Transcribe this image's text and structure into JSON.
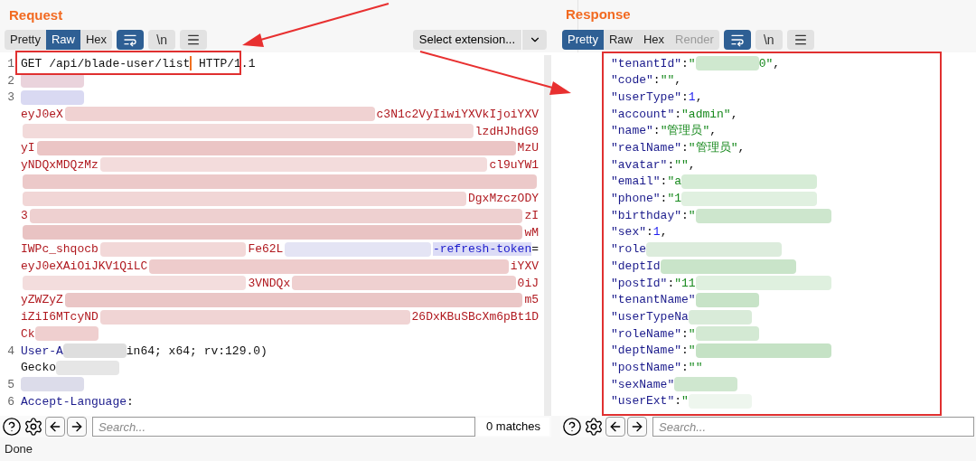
{
  "request": {
    "title": "Request",
    "view_tabs": [
      {
        "label": "Pretty",
        "selected": false
      },
      {
        "label": "Raw",
        "selected": true
      },
      {
        "label": "Hex",
        "selected": false
      }
    ],
    "tool_buttons": [
      {
        "kind": "wrap",
        "selected": true
      },
      {
        "kind": "newline",
        "label": "\\n",
        "selected": false
      },
      {
        "kind": "menu",
        "selected": false
      }
    ],
    "extension_select": "Select extension...",
    "lines": [
      {
        "number": "1",
        "segments": [
          {
            "kind": "plain",
            "text": "GET /api/blade-user/list"
          },
          {
            "kind": "caret"
          },
          {
            "kind": "plain",
            "text": " HTTP/1.1"
          }
        ]
      },
      {
        "number": "2",
        "segments": [
          {
            "kind": "blur_part",
            "color": "#ead3dc"
          }
        ]
      },
      {
        "number": "3",
        "segments": [
          {
            "kind": "blur_part",
            "color": "#d9d9f2"
          }
        ]
      },
      {
        "segments": [
          {
            "kind": "value",
            "text": "eyJ0eX"
          },
          {
            "kind": "blur",
            "color": "#f0d2d2"
          },
          {
            "kind": "value",
            "text": "c3N1c2VyIiwiYXVkIjoiYXV"
          }
        ]
      },
      {
        "segments": [
          {
            "kind": "blur",
            "color": "#f2dada"
          },
          {
            "kind": "value",
            "text": "lzdHJhdG9"
          }
        ]
      },
      {
        "segments": [
          {
            "kind": "value",
            "text": "yI"
          },
          {
            "kind": "blur",
            "color": "#ebc5c5"
          },
          {
            "kind": "value",
            "text": "MzU"
          }
        ]
      },
      {
        "segments": [
          {
            "kind": "value",
            "text": "yNDQxMDQzMz"
          },
          {
            "kind": "blur",
            "color": "#f3dcdc"
          },
          {
            "kind": "value",
            "text": "cl9uYW1"
          }
        ]
      },
      {
        "segments": [
          {
            "kind": "blur",
            "color": "#ecc9c9"
          }
        ]
      },
      {
        "segments": [
          {
            "kind": "blur",
            "color": "#f1d6d6"
          },
          {
            "kind": "value",
            "text": "DgxMzczODY"
          }
        ]
      },
      {
        "segments": [
          {
            "kind": "value",
            "text": "3"
          },
          {
            "kind": "blur",
            "color": "#eed0d0"
          },
          {
            "kind": "value",
            "text": "zI"
          }
        ]
      },
      {
        "segments": [
          {
            "kind": "blur",
            "color": "#e9c3c3"
          },
          {
            "kind": "value",
            "text": "wM"
          }
        ]
      },
      {
        "segments": [
          {
            "kind": "value",
            "text": "IWPc_shqocb"
          },
          {
            "kind": "blur",
            "color": "#f2d8d8"
          },
          {
            "kind": "value",
            "text": "Fe62L"
          },
          {
            "kind": "blur",
            "color": "#e4e4f4"
          },
          {
            "kind": "param",
            "text": "-refresh-token"
          },
          {
            "kind": "plain",
            "text": "="
          }
        ]
      },
      {
        "segments": [
          {
            "kind": "value",
            "text": "eyJ0eXAiOiJKV1QiLC"
          },
          {
            "kind": "blur",
            "color": "#eecccc"
          },
          {
            "kind": "value",
            "text": "iYXV"
          }
        ]
      },
      {
        "segments": [
          {
            "kind": "blur",
            "color": "#f3dddd"
          },
          {
            "kind": "value",
            "text": "3VNDQx"
          },
          {
            "kind": "blur",
            "color": "#efd0d0"
          },
          {
            "kind": "value",
            "text": "0iJ"
          }
        ]
      },
      {
        "segments": [
          {
            "kind": "value",
            "text": "yZWZyZ"
          },
          {
            "kind": "blur",
            "color": "#eac6c6"
          },
          {
            "kind": "value",
            "text": "m5"
          }
        ]
      },
      {
        "segments": [
          {
            "kind": "value",
            "text": "iZiI6MTcyND"
          },
          {
            "kind": "blur",
            "color": "#f0d4d4"
          },
          {
            "kind": "value",
            "text": "26DxKBuSBcXm6pBt1D"
          }
        ]
      },
      {
        "segments": [
          {
            "kind": "value",
            "text": "Ck"
          },
          {
            "kind": "blur_part",
            "color": "#efcfcf"
          }
        ]
      },
      {
        "number": "4",
        "segments": [
          {
            "kind": "name",
            "text": "User-A"
          },
          {
            "kind": "blur_part",
            "color": "#dedede"
          },
          {
            "kind": "plain",
            "text": "in64; x64; rv:129.0)"
          }
        ]
      },
      {
        "segments": [
          {
            "kind": "plain",
            "text": "Gecko"
          },
          {
            "kind": "blur_part",
            "color": "#e6e6e6"
          }
        ]
      },
      {
        "number": "5",
        "segments": [
          {
            "kind": "blur_part",
            "color": "#dcdcea"
          }
        ]
      },
      {
        "number": "6",
        "segments": [
          {
            "kind": "name",
            "text": "Accept-Language"
          },
          {
            "kind": "plain",
            "text": ":"
          }
        ]
      }
    ],
    "search": {
      "placeholder": "Search..."
    },
    "matches": "0 matches"
  },
  "response": {
    "title": "Response",
    "view_tabs": [
      {
        "label": "Pretty",
        "selected": true,
        "disabled": false
      },
      {
        "label": "Raw",
        "selected": false,
        "disabled": false
      },
      {
        "label": "Hex",
        "selected": false,
        "disabled": false
      },
      {
        "label": "Render",
        "selected": false,
        "disabled": true
      }
    ],
    "tool_buttons": [
      {
        "kind": "wrap",
        "selected": true
      },
      {
        "kind": "newline",
        "label": "\\n",
        "selected": false
      },
      {
        "kind": "menu",
        "selected": false
      }
    ],
    "lines": [
      [
        {
          "kind": "key",
          "text": "\"tenantId\""
        },
        {
          "kind": "plain",
          "text": ":"
        },
        {
          "kind": "str",
          "text": "\""
        },
        {
          "kind": "blur_part",
          "color": "#cfe8cf"
        },
        {
          "kind": "str",
          "text": "0\""
        },
        {
          "kind": "plain",
          "text": ","
        }
      ],
      [
        {
          "kind": "key",
          "text": "\"code\""
        },
        {
          "kind": "plain",
          "text": ":"
        },
        {
          "kind": "str",
          "text": "\"\""
        },
        {
          "kind": "plain",
          "text": ","
        }
      ],
      [
        {
          "kind": "key",
          "text": "\"userType\""
        },
        {
          "kind": "plain",
          "text": ":"
        },
        {
          "kind": "num",
          "text": "1"
        },
        {
          "kind": "plain",
          "text": ","
        }
      ],
      [
        {
          "kind": "key",
          "text": "\"account\""
        },
        {
          "kind": "plain",
          "text": ":"
        },
        {
          "kind": "str",
          "text": "\"admin\""
        },
        {
          "kind": "plain",
          "text": ","
        }
      ],
      [
        {
          "kind": "key",
          "text": "\"name\""
        },
        {
          "kind": "plain",
          "text": ":"
        },
        {
          "kind": "str",
          "text": "\"管理员\""
        },
        {
          "kind": "plain",
          "text": ","
        }
      ],
      [
        {
          "kind": "key",
          "text": "\"realName\""
        },
        {
          "kind": "plain",
          "text": ":"
        },
        {
          "kind": "str",
          "text": "\"管理员\""
        },
        {
          "kind": "plain",
          "text": ","
        }
      ],
      [
        {
          "kind": "key",
          "text": "\"avatar\""
        },
        {
          "kind": "plain",
          "text": ":"
        },
        {
          "kind": "str",
          "text": "\"\""
        },
        {
          "kind": "plain",
          "text": ","
        }
      ],
      [
        {
          "kind": "key",
          "text": "\"email\""
        },
        {
          "kind": "plain",
          "text": ":"
        },
        {
          "kind": "str",
          "text": "\"a"
        },
        {
          "kind": "blur_wide",
          "color": "#d6ecd6"
        }
      ],
      [
        {
          "kind": "key",
          "text": "\"phone\""
        },
        {
          "kind": "plain",
          "text": ":"
        },
        {
          "kind": "str",
          "text": "\"1"
        },
        {
          "kind": "blur_wide",
          "color": "#e0f0e0"
        }
      ],
      [
        {
          "kind": "key",
          "text": "\"birthday\""
        },
        {
          "kind": "plain",
          "text": ":"
        },
        {
          "kind": "str",
          "text": "\""
        },
        {
          "kind": "blur_wide",
          "color": "#cde6cd"
        }
      ],
      [
        {
          "kind": "key",
          "text": "\"sex\""
        },
        {
          "kind": "plain",
          "text": ":"
        },
        {
          "kind": "num",
          "text": "1"
        },
        {
          "kind": "plain",
          "text": ","
        }
      ],
      [
        {
          "kind": "key",
          "text": "\"role"
        },
        {
          "kind": "blur_wide",
          "color": "#dcecdc"
        }
      ],
      [
        {
          "kind": "key",
          "text": "\"deptId"
        },
        {
          "kind": "blur_wide",
          "color": "#c9e4c9"
        }
      ],
      [
        {
          "kind": "key",
          "text": "\"postId\""
        },
        {
          "kind": "plain",
          "text": ":"
        },
        {
          "kind": "str",
          "text": "\"11"
        },
        {
          "kind": "blur_wide",
          "color": "#dff0df"
        }
      ],
      [
        {
          "kind": "key",
          "text": "\"tenantName\""
        },
        {
          "kind": "blur_part",
          "color": "#c7e3c7"
        }
      ],
      [
        {
          "kind": "key",
          "text": "\"userTypeNa"
        },
        {
          "kind": "blur_part",
          "color": "#d9ebd9"
        }
      ],
      [
        {
          "kind": "key",
          "text": "\"roleName\""
        },
        {
          "kind": "plain",
          "text": ":"
        },
        {
          "kind": "str",
          "text": "\""
        },
        {
          "kind": "blur_part",
          "color": "#d3e9d3"
        }
      ],
      [
        {
          "kind": "key",
          "text": "\"deptName\""
        },
        {
          "kind": "plain",
          "text": ":"
        },
        {
          "kind": "str",
          "text": "\""
        },
        {
          "kind": "blur_wide",
          "color": "#c5e2c5"
        }
      ],
      [
        {
          "kind": "key",
          "text": "\"postName\""
        },
        {
          "kind": "plain",
          "text": ":"
        },
        {
          "kind": "str",
          "text": "\"\""
        }
      ],
      [
        {
          "kind": "key",
          "text": "\"sexName\""
        },
        {
          "kind": "blur_part",
          "color": "#cfe7cf"
        }
      ],
      [
        {
          "kind": "key",
          "text": "\"userExt\""
        },
        {
          "kind": "plain",
          "text": ":"
        },
        {
          "kind": "str",
          "text": "\""
        },
        {
          "kind": "blur_part",
          "color": "#eef6ee"
        }
      ]
    ],
    "search": {
      "placeholder": "Search..."
    }
  },
  "status": "Done"
}
